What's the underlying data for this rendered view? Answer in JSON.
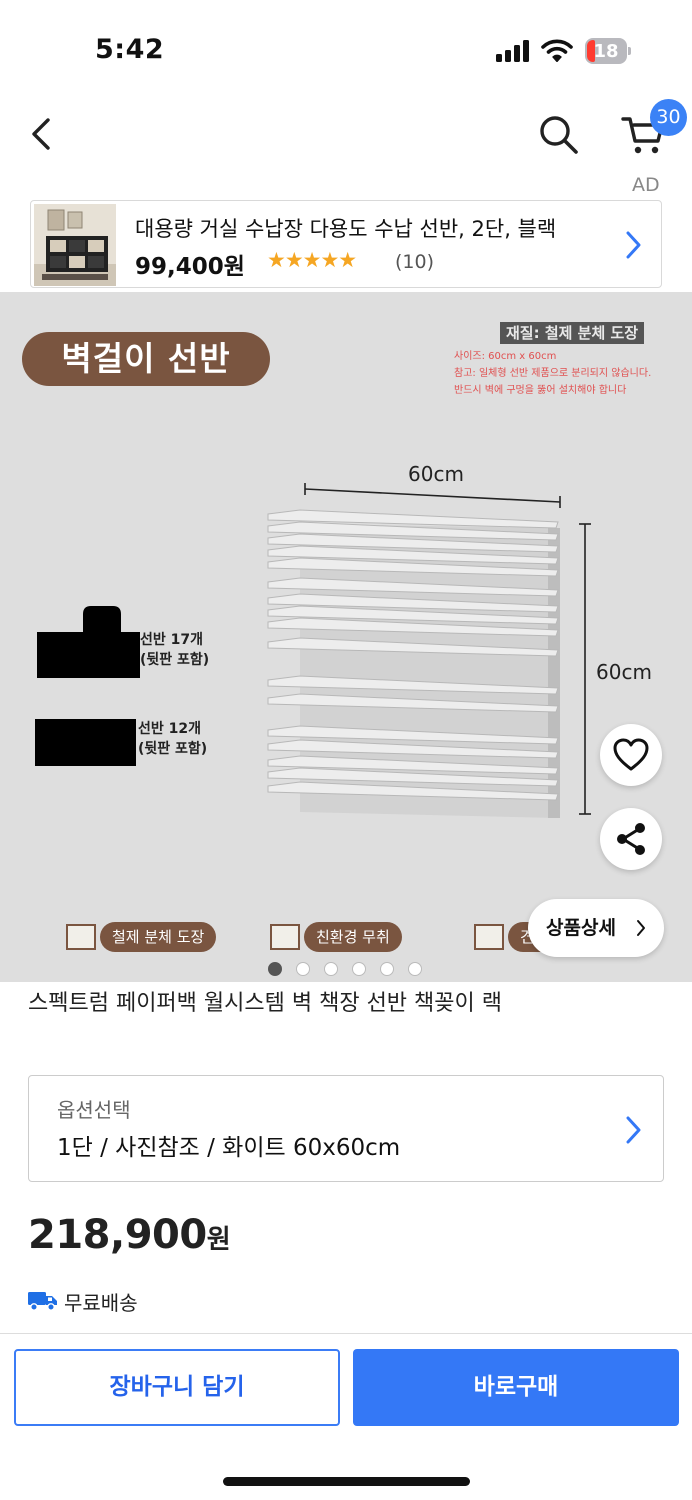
{
  "status_bar": {
    "time": "5:42",
    "battery": "18"
  },
  "nav": {
    "cart_count": "30",
    "ad_label": "AD"
  },
  "ad": {
    "title": "대용량 거실 수납장 다용도 수납 선반, 2단, 블랙",
    "price": "99,400원",
    "stars": "★★★★★",
    "rating": 5,
    "reviews": "(10)"
  },
  "product_image": {
    "tag": "벽걸이 선반",
    "note_title": "재질: 철제 분체 도장",
    "note_lines": [
      "사이즈: 60cm x 60cm",
      "참고: 일체형 선반 제품으로 분리되지 않습니다.",
      "반드시 벽에 구멍을 뚫어 설치해야 합니다"
    ],
    "width_label": "60cm",
    "height_label": "60cm",
    "label_top": [
      "선반 17개",
      "(뒷판 포함)"
    ],
    "label_bottom": [
      "선반 12개",
      "(뒷판 포함)"
    ],
    "features": [
      "철제 분체 도장",
      "친환경 무취",
      "견고"
    ],
    "detail_button": "상품상세",
    "slide_count": 6,
    "active_slide": 0
  },
  "product": {
    "title": "스펙트럼 페이퍼백 월시스템 벽 책장 선반 책꽂이 랙",
    "option_label": "옵션선택",
    "option_value": "1단 / 사진참조 / 화이트 60x60cm",
    "price": "218,900",
    "price_unit": "원",
    "shipping": "무료배송"
  },
  "actions": {
    "cart_button": "장바구니 담기",
    "buy_button": "바로구매"
  },
  "colors": {
    "accent": "#3478f6",
    "badge": "#3b82f6",
    "brand_brown": "#7a5540",
    "star": "#f5a623"
  }
}
